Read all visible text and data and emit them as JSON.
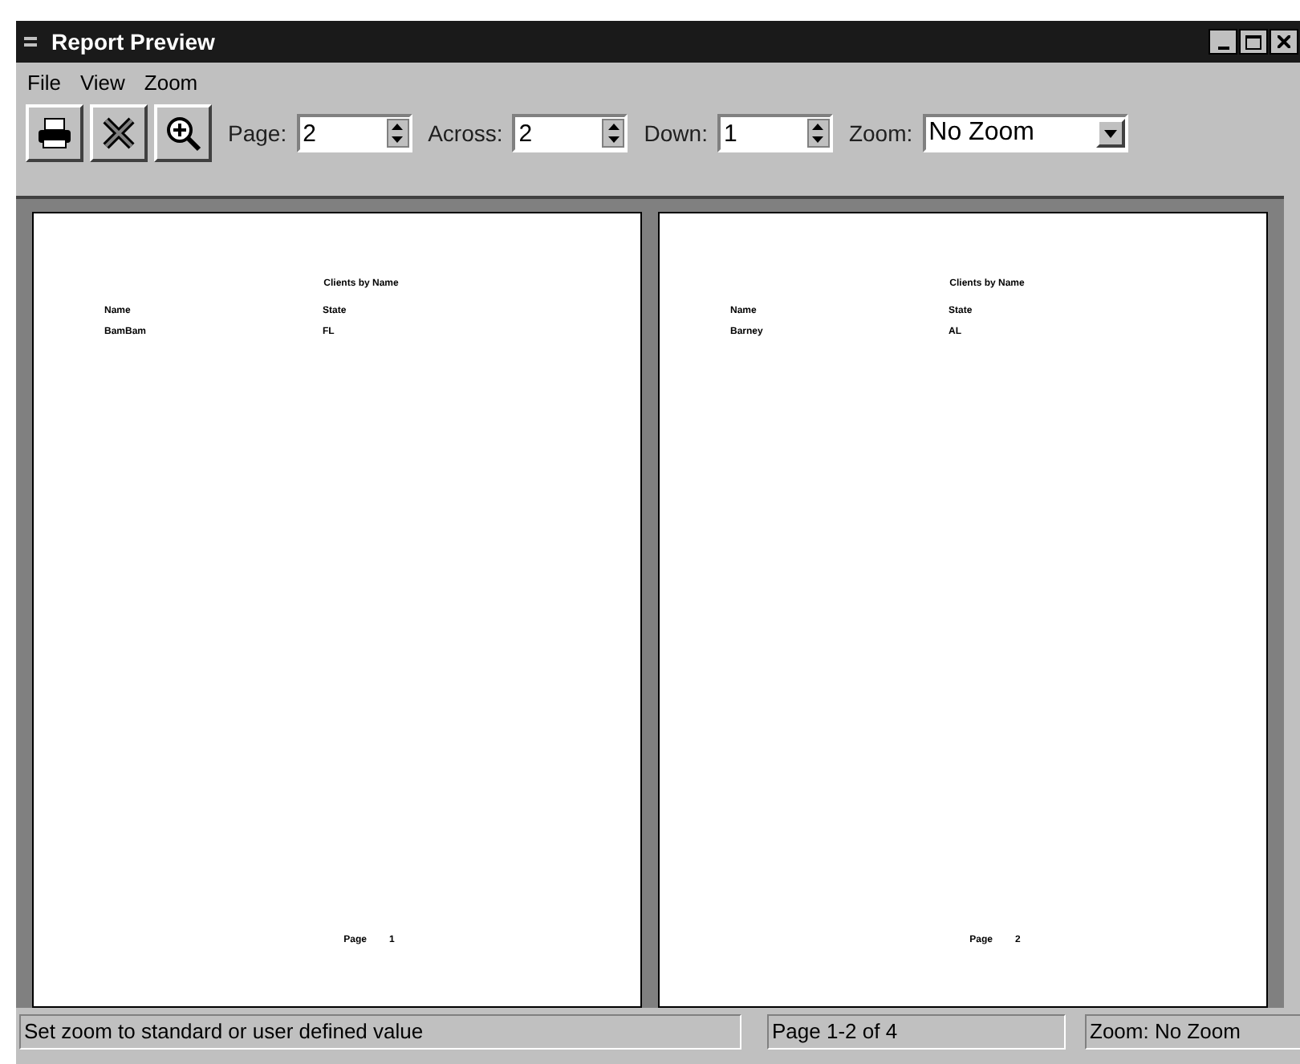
{
  "window": {
    "title": "Report Preview"
  },
  "menu": [
    "File",
    "View",
    "Zoom"
  ],
  "toolbar": {
    "buttons": [
      {
        "kind": "print"
      },
      {
        "kind": "close"
      },
      {
        "kind": "zoom"
      }
    ],
    "spinners": [
      {
        "label": "Page:",
        "value": "2"
      },
      {
        "label": "Across:",
        "value": "2"
      },
      {
        "label": "Down:",
        "value": "1"
      }
    ],
    "zoom": {
      "label": "Zoom:",
      "value": "No Zoom"
    }
  },
  "pages": [
    {
      "title": "Clients by Name",
      "columns": [
        "Name",
        "State"
      ],
      "rows": [
        [
          "BamBam",
          "FL"
        ]
      ],
      "footer": [
        "Page",
        "1"
      ]
    },
    {
      "title": "Clients by Name",
      "columns": [
        "Name",
        "State"
      ],
      "rows": [
        [
          "Barney",
          "AL"
        ]
      ],
      "footer": [
        "Page",
        "2"
      ]
    }
  ],
  "status_bar": [
    "Set zoom to standard or user defined value",
    "Page 1-2 of 4",
    "Zoom: No Zoom"
  ]
}
